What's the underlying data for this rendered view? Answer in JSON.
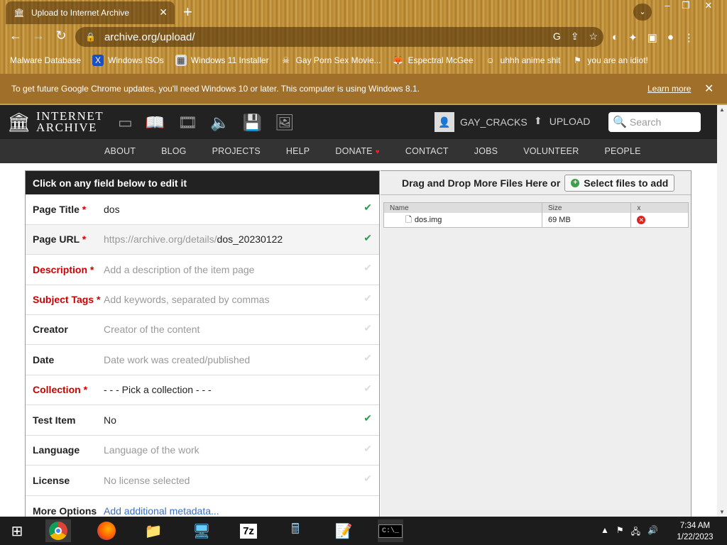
{
  "browser": {
    "tab_title": "Upload to Internet Archive",
    "url": "archive.org/upload/",
    "bookmarks": [
      {
        "label": "Malware Database",
        "icon": "bookmark-icon"
      },
      {
        "label": "Windows ISOs",
        "icon": "x-icon"
      },
      {
        "label": "Windows 11 Installer",
        "icon": "image-icon"
      },
      {
        "label": "Gay Porn Sex Movie...",
        "icon": "skull-icon"
      },
      {
        "label": "Espectral McGee",
        "icon": "fox-icon"
      },
      {
        "label": "uhhh anime shit",
        "icon": "face-icon"
      },
      {
        "label": "you are an idiot!",
        "icon": "flag-icon"
      }
    ],
    "infobar_text": "To get future Google Chrome updates, you'll need Windows 10 or later. This computer is using Windows 8.1.",
    "infobar_link": "Learn more"
  },
  "ia": {
    "logo_line1": "INTERNET",
    "logo_line2": "ARCHIVE",
    "username": "GAY_CRACKS",
    "upload_label": "UPLOAD",
    "search_placeholder": "Search",
    "nav": [
      "ABOUT",
      "BLOG",
      "PROJECTS",
      "HELP",
      "DONATE",
      "CONTACT",
      "JOBS",
      "VOLUNTEER",
      "PEOPLE"
    ]
  },
  "form": {
    "heading": "Click on any field below to edit it",
    "rows": [
      {
        "label": "Page Title",
        "required": true,
        "value": "dos",
        "placeholder": false,
        "checked": true
      },
      {
        "label": "Page URL",
        "required": true,
        "prefix": "https://archive.org/details/",
        "value": "dos_20230122",
        "checked": true
      },
      {
        "label": "Description",
        "required": true,
        "value": "Add a description of the item page",
        "placeholder": true,
        "checked": false
      },
      {
        "label": "Subject Tags",
        "required": true,
        "value": "Add keywords, separated by commas",
        "placeholder": true,
        "checked": false
      },
      {
        "label": "Creator",
        "required": false,
        "value": "Creator of the content",
        "placeholder": true,
        "checked": false
      },
      {
        "label": "Date",
        "required": false,
        "value": "Date work was created/published",
        "placeholder": true,
        "checked": false
      },
      {
        "label": "Collection",
        "required": true,
        "value": "- - - Pick a collection - - -",
        "placeholder": false,
        "checked": false
      },
      {
        "label": "Test Item",
        "required": false,
        "value": "No",
        "placeholder": false,
        "checked": true
      },
      {
        "label": "Language",
        "required": false,
        "value": "Language of the work",
        "placeholder": true,
        "checked": false
      },
      {
        "label": "License",
        "required": false,
        "value": "No license selected",
        "placeholder": true,
        "checked": false
      },
      {
        "label": "More Options",
        "required": false,
        "value": "Add additional metadata...",
        "placeholder": false,
        "checked": false
      }
    ]
  },
  "files": {
    "drop_text": "Drag and Drop More Files Here or",
    "select_label": "Select files to add",
    "columns": [
      "Name",
      "Size",
      "x"
    ],
    "rows": [
      {
        "name": "dos.img",
        "size": "69 MB"
      }
    ]
  },
  "taskbar": {
    "time": "7:34 AM",
    "date": "1/22/2023"
  }
}
